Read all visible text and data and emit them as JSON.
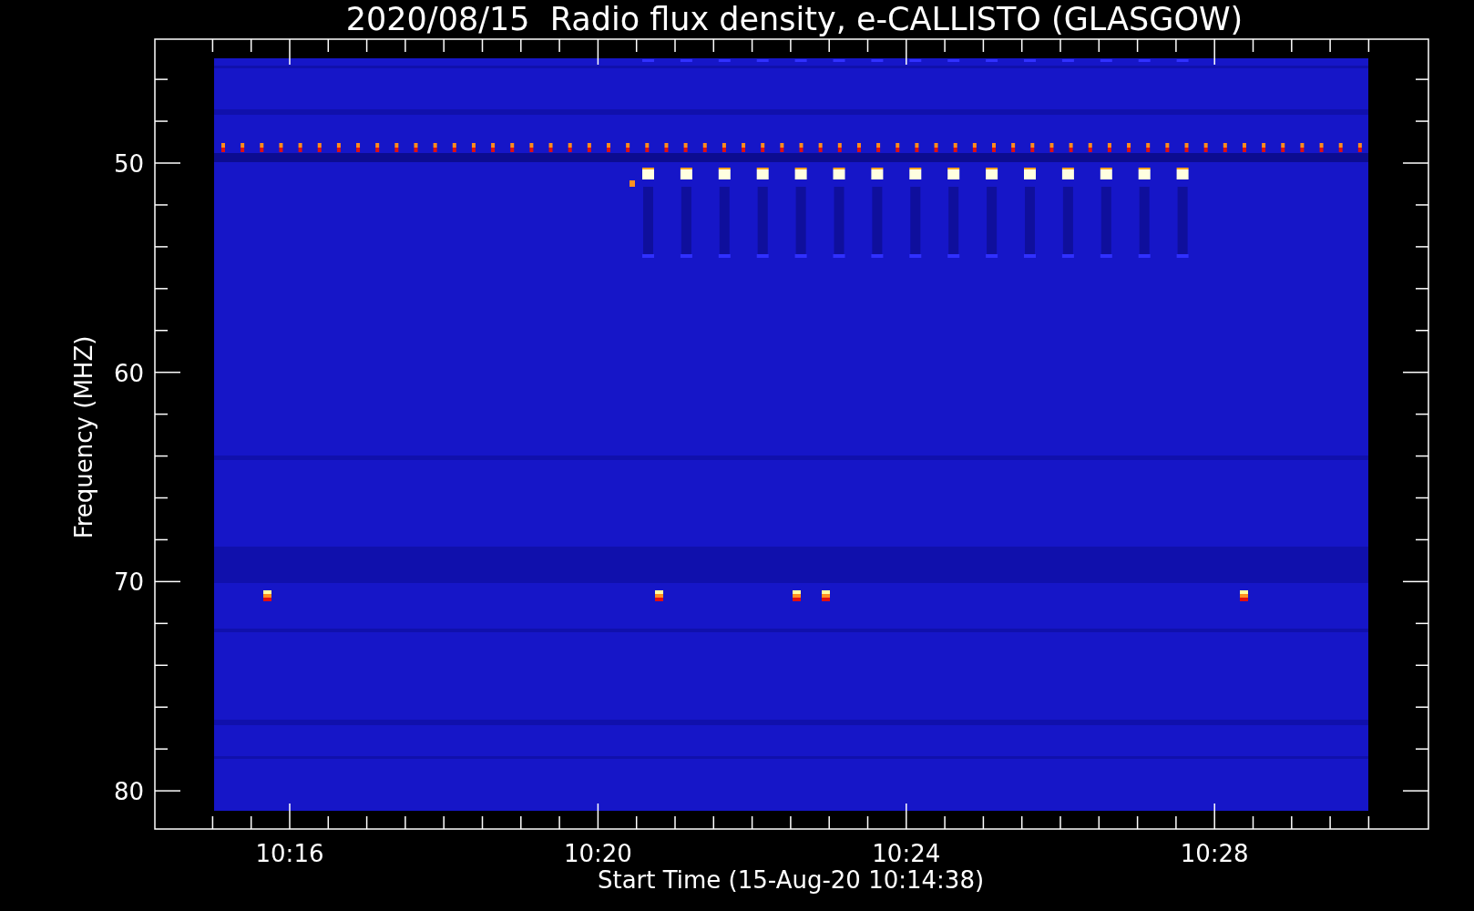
{
  "title": "2020/08/15  Radio flux density, e-CALLISTO (GLASGOW)",
  "y_axis": {
    "label": "Frequency (MHZ)",
    "ticks": [
      "50",
      "60",
      "70",
      "80"
    ]
  },
  "x_axis": {
    "label": "Start Time (15-Aug-20 10:14:38)",
    "ticks": [
      "10:16",
      "10:20",
      "10:24",
      "10:28"
    ]
  }
}
